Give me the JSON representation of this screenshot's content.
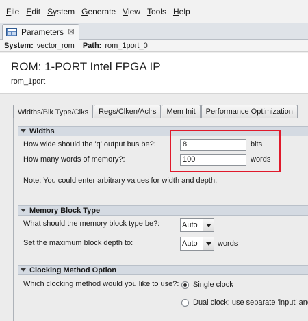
{
  "menubar": {
    "items": [
      {
        "mnemonic": "F",
        "rest": "ile"
      },
      {
        "mnemonic": "E",
        "rest": "dit"
      },
      {
        "mnemonic": "S",
        "rest": "ystem"
      },
      {
        "mnemonic": "G",
        "rest": "enerate"
      },
      {
        "mnemonic": "V",
        "rest": "iew"
      },
      {
        "mnemonic": "T",
        "rest": "ools"
      },
      {
        "mnemonic": "H",
        "rest": "elp"
      }
    ]
  },
  "view_tab": {
    "label": "Parameters",
    "close": "⊠"
  },
  "system_bar": {
    "system_key": "System:",
    "system_value": "vector_rom",
    "path_key": "Path:",
    "path_value": "rom_1port_0"
  },
  "header": {
    "title": "ROM: 1-PORT Intel FPGA IP",
    "subtitle": "rom_1port"
  },
  "param_tabs": [
    "Widths/Blk Type/Clks",
    "Regs/Clken/Aclrs",
    "Mem Init",
    "Performance Optimization"
  ],
  "widths": {
    "title": "Widths",
    "q_width_label": "How wide should the 'q' output bus be?:",
    "q_width_value": "8",
    "q_width_unit": "bits",
    "words_label": "How many words of memory?:",
    "words_value": "100",
    "words_unit": "words",
    "note": "Note: You could enter arbitrary values for width and depth."
  },
  "memory_block": {
    "title": "Memory Block Type",
    "type_label": "What should the memory block type be?:",
    "type_value": "Auto",
    "depth_label": "Set the maximum block depth to:",
    "depth_value": "Auto",
    "depth_unit": "words"
  },
  "clocking": {
    "title": "Clocking Method Option",
    "question": "Which clocking method would you like to use?:",
    "option_single": "Single clock",
    "option_dual": "Dual clock: use separate 'input' and"
  },
  "colors": {
    "highlight": "#e0192b",
    "group_header": "#d4dae2"
  }
}
